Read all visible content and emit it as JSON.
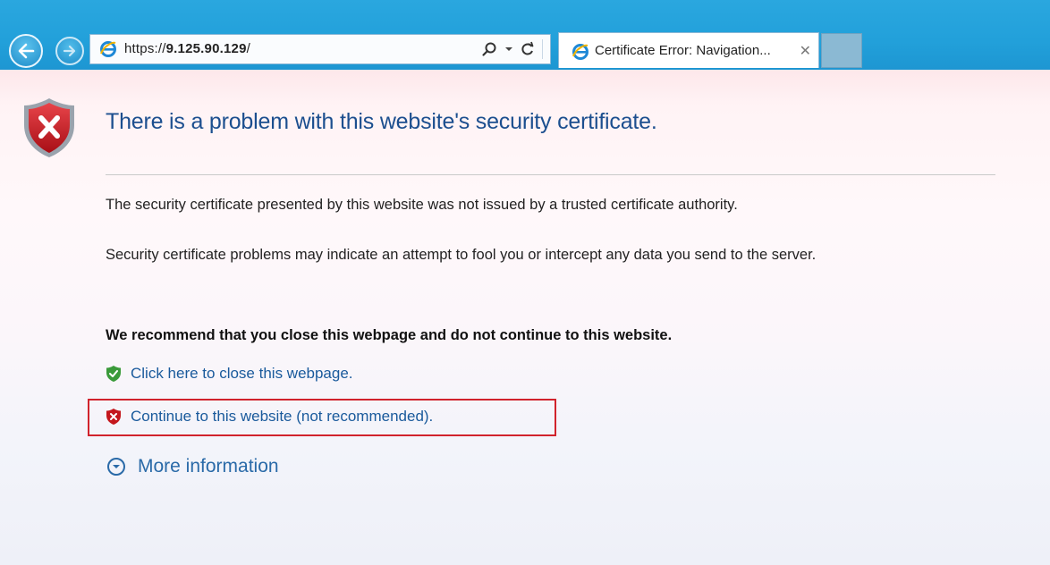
{
  "browser": {
    "address_bar": {
      "url_prefix": "https://",
      "url_host": "9.125.90.129",
      "url_suffix": "/"
    },
    "search_icon": "search-icon",
    "refresh_icon": "refresh-icon",
    "tab": {
      "title": "Certificate Error: Navigation...",
      "close_label": "✕"
    }
  },
  "page": {
    "heading": "There is a problem with this website's security certificate.",
    "paragraph1": "The security certificate presented by this website was not issued by a trusted certificate authority.",
    "paragraph2": "Security certificate problems may indicate an attempt to fool you or intercept any data you send to the server.",
    "recommendation": "We recommend that you close this webpage and do not continue to this website.",
    "close_link": "Click here to close this webpage.",
    "continue_link": "Continue to this website (not recommended).",
    "more_info": "More information"
  },
  "colors": {
    "chrome_blue": "#22a0da",
    "heading_blue": "#1c4f8f",
    "link_blue": "#1a5a9c",
    "highlight_red": "#d1232c",
    "shield_red": "#c4161c",
    "shield_green": "#3a9a3a"
  }
}
